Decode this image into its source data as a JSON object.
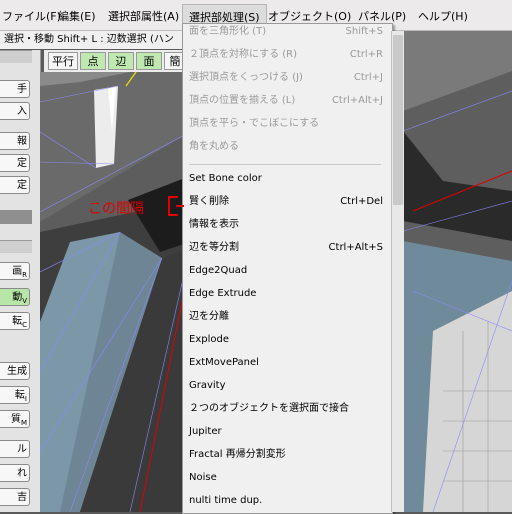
{
  "menubar": {
    "items": [
      "ファイル(F)",
      "編集(E)",
      "選択部属性(A)",
      "選択部処理(S)",
      "オブジェクト(O)",
      "パネル(P)",
      "ヘルプ(H)"
    ]
  },
  "mode_line": "選択・移動  Shift+ L : 辺数選択 (ハン",
  "left_panel": {
    "buttons": [
      {
        "label": "手",
        "key": ""
      },
      {
        "label": "入",
        "key": ""
      },
      {
        "label": "報",
        "key": ""
      },
      {
        "label": "定",
        "key": ""
      },
      {
        "label": "定",
        "key": ""
      },
      {
        "label": "画",
        "key": "R"
      },
      {
        "label": "動",
        "key": "V"
      },
      {
        "label": "転",
        "key": "C"
      },
      {
        "label": "生成",
        "key": ""
      },
      {
        "label": "転",
        "key": "I"
      },
      {
        "label": "質",
        "key": "M"
      },
      {
        "label": "ル",
        "key": ""
      },
      {
        "label": "れ",
        "key": ""
      },
      {
        "label": "吉",
        "key": ""
      }
    ]
  },
  "view_bar": {
    "parallel": "平行",
    "point": "点",
    "edge": "辺",
    "face": "面",
    "extra": "簡"
  },
  "dropdown": {
    "top_items": [
      {
        "label": "面を三角形化 (T)",
        "shortcut": "Shift+S",
        "enabled": false
      },
      {
        "label": "２頂点を対称にする (R)",
        "shortcut": "Ctrl+R",
        "enabled": false
      },
      {
        "label": "選択頂点をくっつける (J)",
        "shortcut": "Ctrl+J",
        "enabled": false
      },
      {
        "label": "頂点の位置を揃える (L)",
        "shortcut": "Ctrl+Alt+J",
        "enabled": false
      },
      {
        "label": "頂点を平ら・でこぼこにする",
        "shortcut": "",
        "enabled": false
      },
      {
        "label": "角を丸める",
        "shortcut": "",
        "enabled": false
      }
    ],
    "plugin_items": [
      {
        "label": "Set Bone color",
        "shortcut": ""
      },
      {
        "label": "賢く削除",
        "shortcut": "Ctrl+Del"
      },
      {
        "label": "情報を表示",
        "shortcut": ""
      },
      {
        "label": "辺を等分割",
        "shortcut": "Ctrl+Alt+S"
      },
      {
        "label": "Edge2Quad",
        "shortcut": ""
      },
      {
        "label": "Edge Extrude",
        "shortcut": ""
      },
      {
        "label": "辺を分離",
        "shortcut": ""
      },
      {
        "label": "Explode",
        "shortcut": ""
      },
      {
        "label": "ExtMovePanel",
        "shortcut": ""
      },
      {
        "label": "Gravity",
        "shortcut": ""
      },
      {
        "label": "２つのオブジェクトを選択面で接合",
        "shortcut": ""
      },
      {
        "label": "Jupiter",
        "shortcut": ""
      },
      {
        "label": "Fractal 再帰分割変形",
        "shortcut": ""
      },
      {
        "label": "Noise",
        "shortcut": ""
      },
      {
        "label": "nulti time dup.",
        "shortcut": ""
      }
    ]
  },
  "annotation": "この間隔",
  "colors": {
    "accent_red": "#e00000",
    "active_green": "#bfe9b1",
    "mesh_blue": "#7b97a8"
  }
}
